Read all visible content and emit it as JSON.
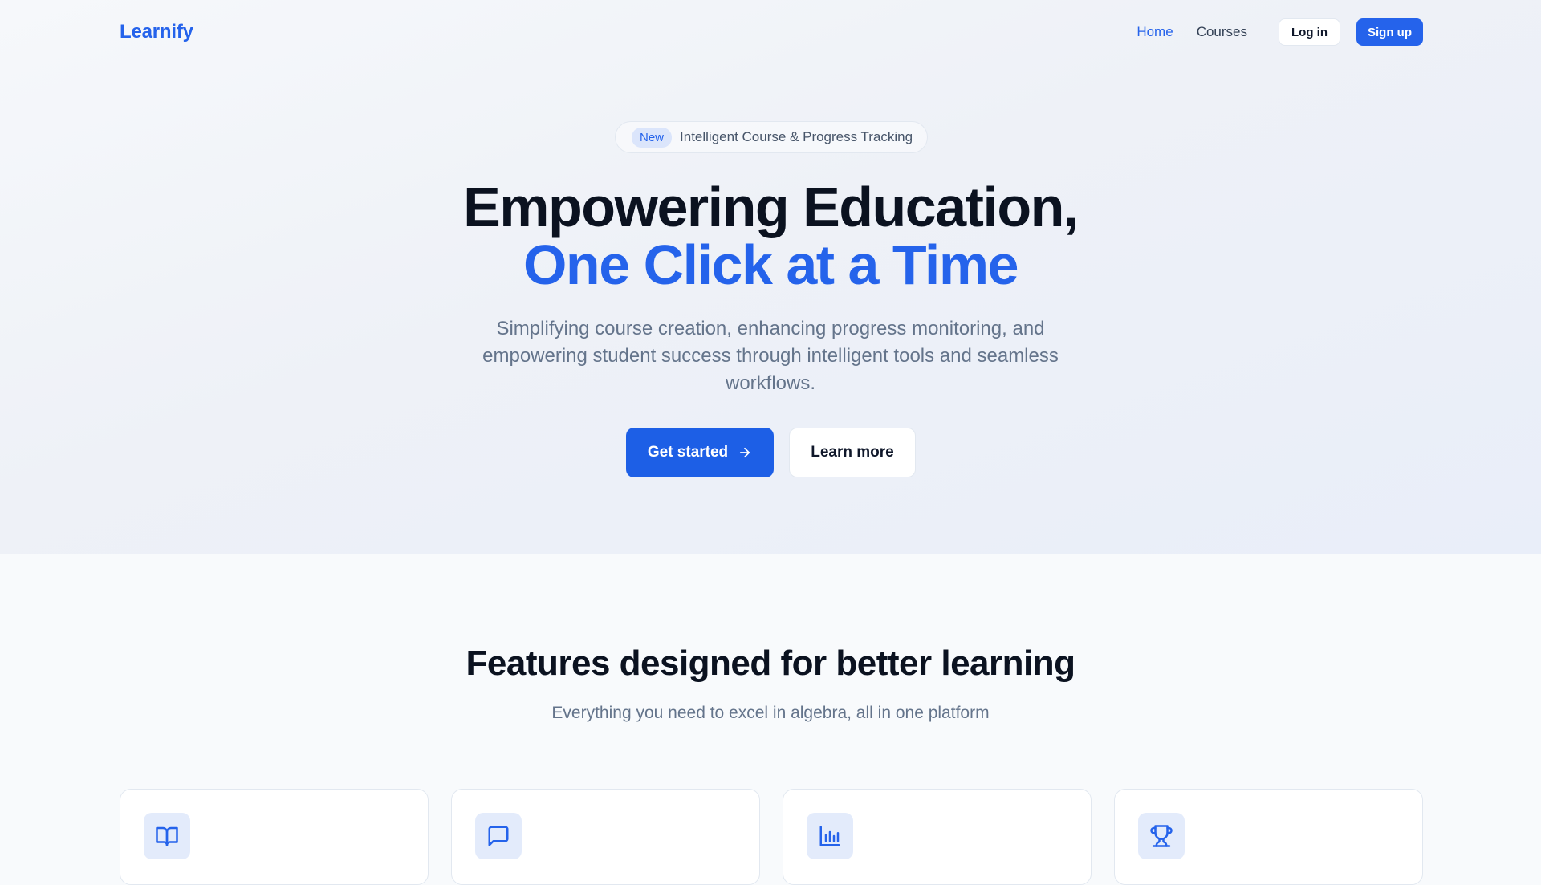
{
  "nav": {
    "logo": "Learnify",
    "links": [
      {
        "label": "Home",
        "active": true
      },
      {
        "label": "Courses",
        "active": false
      }
    ],
    "login_label": "Log in",
    "signup_label": "Sign up"
  },
  "hero": {
    "badge_pill": "New",
    "badge_text": "Intelligent Course & Progress Tracking",
    "title_line1": "Empowering Education,",
    "title_line2": "One Click at a Time",
    "subtitle": "Simplifying course creation, enhancing progress monitoring, and empowering student success through intelligent tools and seamless workflows.",
    "cta_primary": "Get started",
    "cta_secondary": "Learn more"
  },
  "features": {
    "title": "Features designed for better learning",
    "subtitle": "Everything you need to excel in algebra, all in one platform",
    "cards": [
      {
        "icon": "book-open-icon"
      },
      {
        "icon": "message-square-icon"
      },
      {
        "icon": "bar-chart-icon"
      },
      {
        "icon": "trophy-icon"
      }
    ]
  },
  "colors": {
    "accent": "#2563eb",
    "text_dark": "#0b1220",
    "text_muted": "#64748b",
    "icon_bg": "#e3ebfb"
  }
}
